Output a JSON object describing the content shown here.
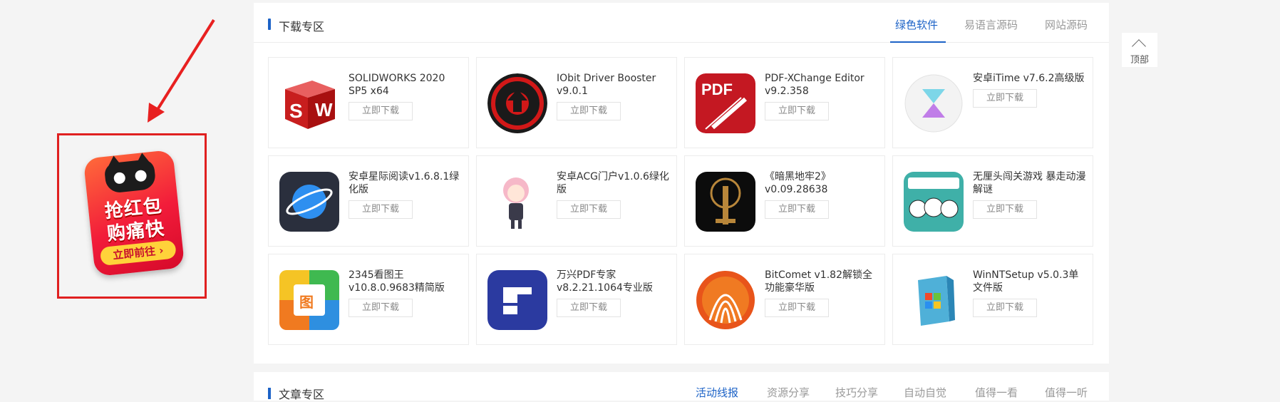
{
  "section": {
    "title": "下载专区",
    "tabs": [
      "绿色软件",
      "易语言源码",
      "网站源码"
    ]
  },
  "apps": [
    {
      "name": "SOLIDWORKS 2020 SP5 x64",
      "icon": "solidworks-icon"
    },
    {
      "name": "IObit Driver Booster v9.0.1",
      "icon": "driver-booster-icon"
    },
    {
      "name": "PDF-XChange Editor v9.2.358",
      "icon": "pdf-xchange-icon"
    },
    {
      "name": "安卓iTime v7.6.2高级版",
      "icon": "itime-icon"
    },
    {
      "name": "安卓星际阅读v1.6.8.1绿化版",
      "icon": "planet-reader-icon"
    },
    {
      "name": "安卓ACG门户v1.0.6绿化版",
      "icon": "anime-girl-icon"
    },
    {
      "name": "《暗黑地牢2》v0.09.28638",
      "icon": "darkest-dungeon-icon"
    },
    {
      "name": "无厘头闯关游戏 暴走动漫解谜",
      "icon": "rage-comic-icon"
    },
    {
      "name": "2345看图王v10.8.0.9683精简版",
      "icon": "2345-viewer-icon"
    },
    {
      "name": "万兴PDF专家v8.2.21.1064专业版",
      "icon": "wondershare-pdf-icon"
    },
    {
      "name": "BitComet v1.82解锁全功能豪华版",
      "icon": "bitcomet-icon"
    },
    {
      "name": "WinNTSetup v5.0.3单文件版",
      "icon": "winntsetup-icon"
    }
  ],
  "download_label": "立即下载",
  "promo": {
    "line1": "抢红包",
    "line2": "购痛快",
    "button": "立即前往 ›"
  },
  "back_to_top": "顶部",
  "next_section": {
    "title": "文章专区",
    "tabs": [
      "活动线报",
      "资源分享",
      "技巧分享",
      "自动自觉",
      "值得一看",
      "值得一听"
    ]
  },
  "colors": {
    "accent": "#1d63c7",
    "annotation": "#e02020"
  }
}
